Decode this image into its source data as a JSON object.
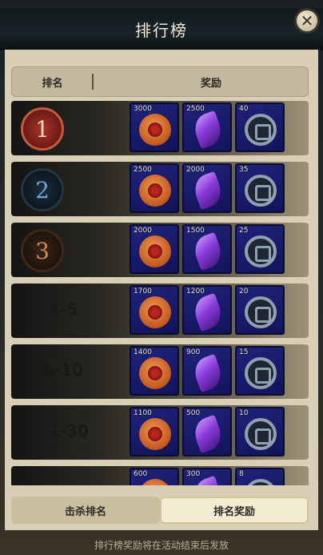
{
  "title": "排行榜",
  "close_glyph": "✕",
  "header": {
    "rank": "排名",
    "reward": "奖励"
  },
  "rows": [
    {
      "rank": "1",
      "items": [
        {
          "qty": "3000",
          "icon": "coin-icon"
        },
        {
          "qty": "2500",
          "icon": "purple-flame-icon"
        },
        {
          "qty": "40",
          "icon": "ring-icon"
        }
      ]
    },
    {
      "rank": "2",
      "items": [
        {
          "qty": "2500",
          "icon": "coin-icon"
        },
        {
          "qty": "2000",
          "icon": "purple-flame-icon"
        },
        {
          "qty": "35",
          "icon": "ring-icon"
        }
      ]
    },
    {
      "rank": "3",
      "items": [
        {
          "qty": "2000",
          "icon": "coin-icon"
        },
        {
          "qty": "1500",
          "icon": "purple-flame-icon"
        },
        {
          "qty": "25",
          "icon": "ring-icon"
        }
      ]
    },
    {
      "rank": "4-5",
      "items": [
        {
          "qty": "1700",
          "icon": "coin-icon"
        },
        {
          "qty": "1200",
          "icon": "purple-flame-icon"
        },
        {
          "qty": "20",
          "icon": "ring-icon"
        }
      ]
    },
    {
      "rank": "6-10",
      "items": [
        {
          "qty": "1400",
          "icon": "coin-icon"
        },
        {
          "qty": "900",
          "icon": "purple-flame-icon"
        },
        {
          "qty": "15",
          "icon": "ring-icon"
        }
      ]
    },
    {
      "rank": "11-30",
      "items": [
        {
          "qty": "1100",
          "icon": "coin-icon"
        },
        {
          "qty": "500",
          "icon": "purple-flame-icon"
        },
        {
          "qty": "10",
          "icon": "ring-icon"
        }
      ]
    },
    {
      "rank": "",
      "items": [
        {
          "qty": "600",
          "icon": "coin-icon"
        },
        {
          "qty": "300",
          "icon": "purple-flame-icon"
        },
        {
          "qty": "8",
          "icon": "ring-icon"
        }
      ]
    }
  ],
  "tabs": {
    "left": "击杀排名",
    "right": "排名奖励"
  },
  "footer": "排行榜奖励将在活动结束后发放"
}
